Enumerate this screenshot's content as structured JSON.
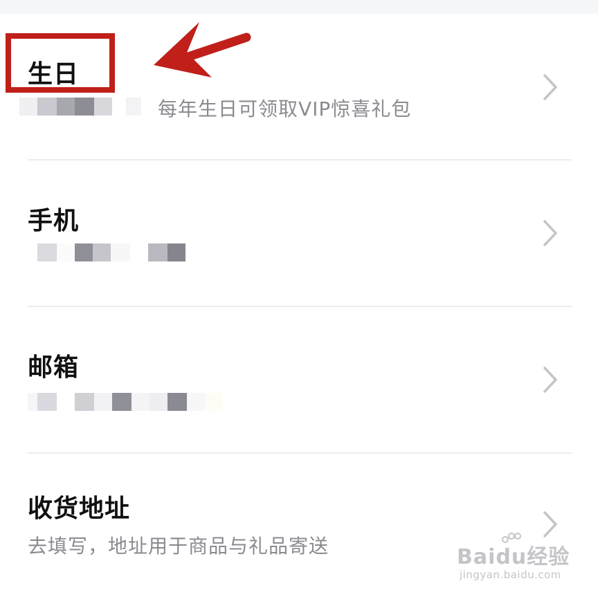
{
  "profile": {
    "rows": [
      {
        "title": "生日",
        "subtitle": "每年生日可领取VIP惊喜礼包"
      },
      {
        "title": "手机",
        "subtitle": ""
      },
      {
        "title": "邮箱",
        "subtitle": ""
      },
      {
        "title": "收货地址",
        "subtitle": "去填写，地址用于商品与礼品寄送"
      }
    ]
  },
  "icons": {
    "chevron": "chevron-right-icon",
    "arrow": "red-arrow-annotation",
    "highlight": "red-highlight-box"
  },
  "colors": {
    "annotation": "#c01f1a",
    "title": "#111111",
    "subtitle": "#8a8a90",
    "divider": "#ececef"
  },
  "watermark": {
    "main": "Baidu经验",
    "sub": "jingyan.baidu.com"
  }
}
